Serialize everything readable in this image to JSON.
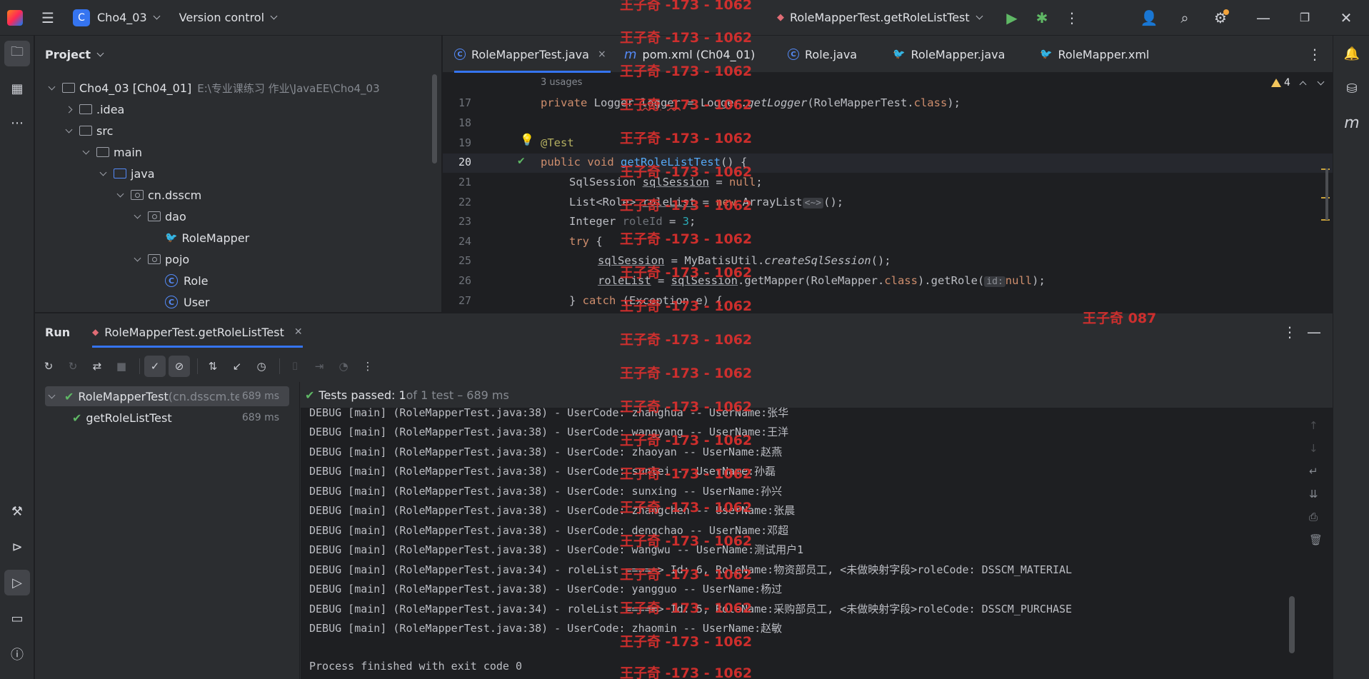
{
  "titlebar": {
    "project_initial": "C",
    "project_name": "Cho4_03",
    "vcs_label": "Version control",
    "run_config": "RoleMapperTest.getRoleListTest"
  },
  "project_panel": {
    "title": "Project",
    "tree": [
      {
        "label": "Cho4_03 [Ch04_01]",
        "hint": "E:\\专业课练习 作业\\JavaEE\\Cho4_03",
        "kind": "module"
      },
      {
        "label": ".idea",
        "kind": "folder"
      },
      {
        "label": "src",
        "kind": "folder"
      },
      {
        "label": "main",
        "kind": "folder"
      },
      {
        "label": "java",
        "kind": "source"
      },
      {
        "label": "cn.dsscm",
        "kind": "package"
      },
      {
        "label": "dao",
        "kind": "package"
      },
      {
        "label": "RoleMapper",
        "kind": "mapper"
      },
      {
        "label": "pojo",
        "kind": "package"
      },
      {
        "label": "Role",
        "kind": "class"
      },
      {
        "label": "User",
        "kind": "class"
      }
    ]
  },
  "editor": {
    "tabs": [
      {
        "label": "RoleMapperTest.java",
        "icon": "class-icon",
        "close": "×"
      },
      {
        "label": "pom.xml (Ch04_01)",
        "icon": "maven-icon"
      },
      {
        "label": "Role.java",
        "icon": "class-icon"
      },
      {
        "label": "RoleMapper.java",
        "icon": "mapper-icon"
      },
      {
        "label": "RoleMapper.xml",
        "icon": "xml-icon"
      }
    ],
    "usages": "3 usages",
    "warnings_count": "4",
    "line_numbers": [
      "17",
      "18",
      "19",
      "20",
      "21",
      "22",
      "23",
      "24",
      "25",
      "26",
      "27"
    ],
    "code": {
      "l17": {
        "kw": "private ",
        "type": "Logger ",
        "var": "logger",
        "rest1": " = Logger.",
        "call": "getLogger",
        "rest2": "(RoleMapperTest.",
        "kw2": "class",
        "rest3": ");"
      },
      "l19": "@Test",
      "l20": {
        "kw": "public void ",
        "fn": "getRoleListTest",
        "rest": "() {"
      },
      "l21": {
        "type": "SqlSession ",
        "var": "sqlSession",
        "rest": " = ",
        "kw": "null",
        "end": ";"
      },
      "l22": {
        "type": "List<Role> ",
        "var": "roleList",
        "rest": " = ",
        "kw": "new ",
        "type2": "ArrayList",
        "hint": "<~>",
        "end": "();"
      },
      "l23": {
        "type": "Integer ",
        "var": "roleId",
        "rest": " = ",
        "num": "3",
        "end": ";"
      },
      "l24": {
        "kw": "try",
        "rest": " {"
      },
      "l25": {
        "var": "sqlSession",
        "rest": " = MyBatisUtil.",
        "call": "createSqlSession",
        "end": "();"
      },
      "l26": {
        "var": "roleList",
        "rest": " = ",
        "var2": "sqlSession",
        "rest2": ".getMapper(RoleMapper.",
        "kw": "class",
        "rest3": ").getRole(",
        "hint": "id:",
        "kw2": "null",
        "end": ");"
      },
      "l27": {
        "pre": "} ",
        "kw": "catch",
        "rest": " (Exception e) {"
      }
    }
  },
  "run_panel": {
    "title": "Run",
    "tab_label": "RoleMapperTest.getRoleListTest",
    "tests": [
      {
        "name": "RoleMapperTest",
        "pkg": " (cn.dsscm.te",
        "time": "689 ms"
      },
      {
        "name": "getRoleListTest",
        "time": "689 ms"
      }
    ],
    "status": {
      "passed": "Tests passed: 1",
      "detail": " of 1 test – 689 ms"
    },
    "console_lines": [
      "DEBUG [main] (RoleMapperTest.java:38) - UserCode: zhanghua -- UserName:张华",
      "DEBUG [main] (RoleMapperTest.java:38) - UserCode: wangyang -- UserName:王洋",
      "DEBUG [main] (RoleMapperTest.java:38) - UserCode: zhaoyan -- UserName:赵燕",
      "DEBUG [main] (RoleMapperTest.java:38) - UserCode: sunlei -- UserName:孙磊",
      "DEBUG [main] (RoleMapperTest.java:38) - UserCode: sunxing -- UserName:孙兴",
      "DEBUG [main] (RoleMapperTest.java:38) - UserCode: zhangchen -- UserName:张晨",
      "DEBUG [main] (RoleMapperTest.java:38) - UserCode: dengchao -- UserName:邓超",
      "DEBUG [main] (RoleMapperTest.java:38) - UserCode: wangwu -- UserName:测试用户1",
      "DEBUG [main] (RoleMapperTest.java:34) - roleList =====> Id: 6, RoleName:物资部员工, <未做映射字段>roleCode: DSSCM_MATERIAL",
      "DEBUG [main] (RoleMapperTest.java:38) - UserCode: yangguo -- UserName:杨过",
      "DEBUG [main] (RoleMapperTest.java:34) - roleList =====> Id: 5, RoleName:采购部员工, <未做映射字段>roleCode: DSSCM_PURCHASE",
      "DEBUG [main] (RoleMapperTest.java:38) - UserCode: zhaomin -- UserName:赵敏",
      "",
      "Process finished with exit code 0"
    ]
  },
  "watermark": {
    "main": "王子奇 -173 - 1062",
    "alt": "王子奇 087"
  },
  "colors": {
    "accent": "#3574f0",
    "success": "#5fb865",
    "watermark": "#e0302e",
    "warning": "#f2c55c"
  }
}
